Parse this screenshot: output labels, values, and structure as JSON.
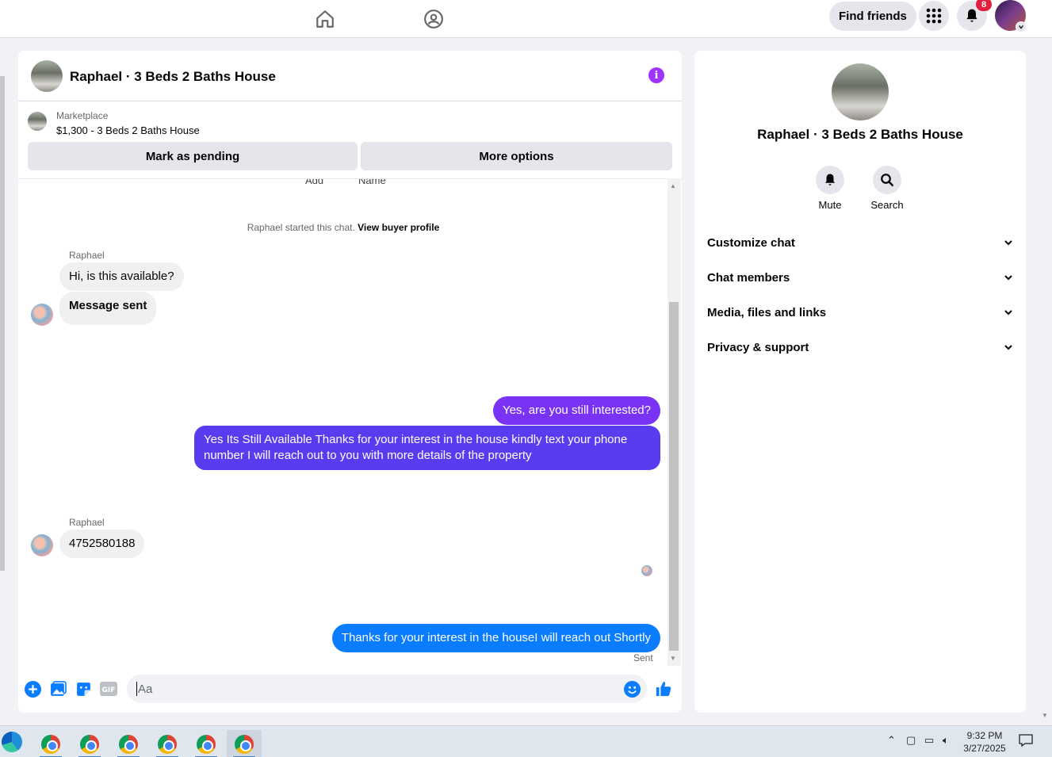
{
  "topnav": {
    "find_friends_label": "Find friends",
    "notification_count": "8"
  },
  "chat": {
    "header_title": "Raphael · 3 Beds 2 Baths House",
    "marketplace_label": "Marketplace",
    "listing_text": "$1,300 - 3 Beds 2 Baths House",
    "mark_pending_label": "Mark as pending",
    "more_options_label": "More options",
    "cut_off_labels": [
      "Add",
      "Name"
    ],
    "system_text": "Raphael started this chat.",
    "view_buyer_profile": "View buyer profile",
    "messages": [
      {
        "sender": "Raphael",
        "text": "Hi, is this available?"
      },
      {
        "text": "Message sent"
      },
      {
        "text": "Yes, are you still interested?",
        "color": "#7a33f5"
      },
      {
        "text": "Yes Its Still Available Thanks for your interest in the house kindly text your phone number I will reach out to you with more details of the property",
        "color": "#5a3cf0"
      },
      {
        "sender": "Raphael",
        "text": "4752580188"
      },
      {
        "text": "Thanks for your interest in the houseI will reach out Shortly",
        "color": "#0a7cff"
      }
    ],
    "sent_status": "Sent",
    "composer_placeholder": "Aa"
  },
  "details": {
    "name": "Raphael · 3 Beds 2 Baths House",
    "mute_label": "Mute",
    "search_label": "Search",
    "sections": [
      "Customize chat",
      "Chat members",
      "Media, files and links",
      "Privacy & support"
    ]
  },
  "taskbar": {
    "time": "9:32 PM",
    "date": "3/27/2025"
  },
  "colors": {
    "accent": "#0a7cff",
    "info": "#a033ff",
    "badge": "#e41e3f"
  }
}
